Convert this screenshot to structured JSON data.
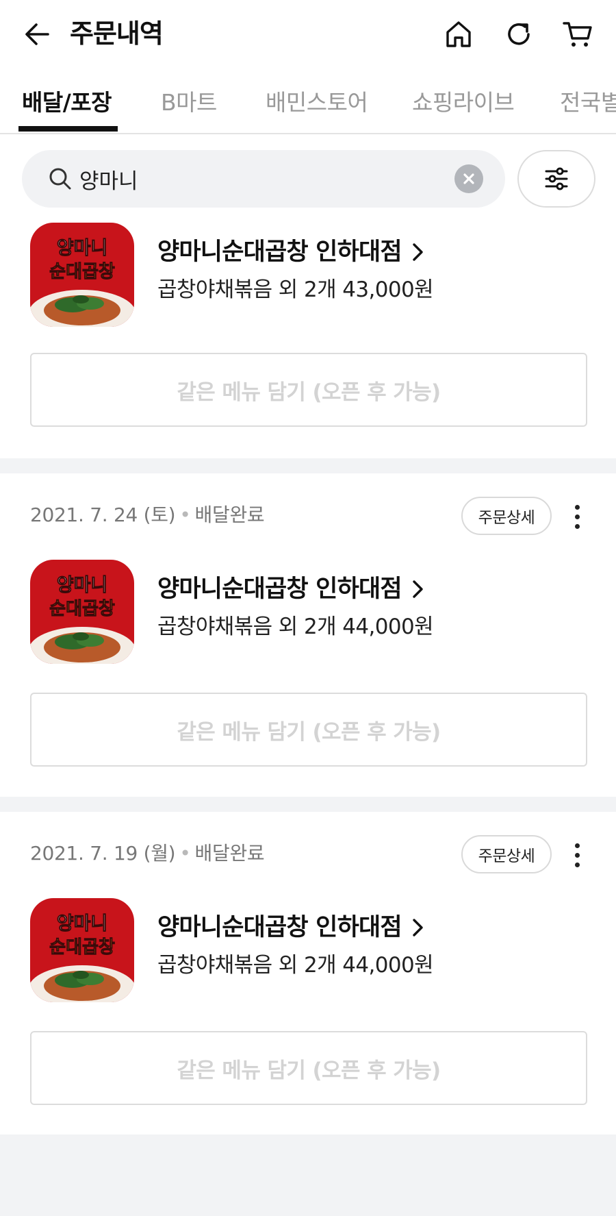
{
  "header": {
    "title": "주문내역",
    "icons": [
      "back-arrow-icon",
      "home-icon",
      "refresh-icon",
      "cart-icon"
    ]
  },
  "tabs": [
    {
      "label": "배달/포장",
      "active": true
    },
    {
      "label": "B마트",
      "active": false
    },
    {
      "label": "배민스토어",
      "active": false
    },
    {
      "label": "쇼핑라이브",
      "active": false
    },
    {
      "label": "전국별미",
      "active": false
    }
  ],
  "search": {
    "value": "양마니",
    "placeholder": ""
  },
  "orders": [
    {
      "date": "",
      "status": "",
      "store_name": "양마니순대곱창 인하대점",
      "summary": "곱창야채볶음 외 2개 43,000원",
      "reorder_label": "같은 메뉴 담기 (오픈 후 가능)"
    },
    {
      "date": "2021. 7. 24 (토)",
      "status": "배달완료",
      "detail_label": "주문상세",
      "store_name": "양마니순대곱창 인하대점",
      "summary": "곱창야채볶음 외 2개 44,000원",
      "reorder_label": "같은 메뉴 담기 (오픈 후 가능)"
    },
    {
      "date": "2021. 7. 19 (월)",
      "status": "배달완료",
      "detail_label": "주문상세",
      "store_name": "양마니순대곱창 인하대점",
      "summary": "곱창야채볶음 외 2개 44,000원",
      "reorder_label": "같은 메뉴 담기 (오픈 후 가능)"
    }
  ],
  "thumbnail": {
    "logo_line1": "양마니",
    "logo_line2": "순대곱창"
  },
  "colors": {
    "logo_red": "#c8141b",
    "logo_yellow": "#ffc21a",
    "gap_gray": "#f2f3f5",
    "disabled_text": "#d3d3d3"
  }
}
